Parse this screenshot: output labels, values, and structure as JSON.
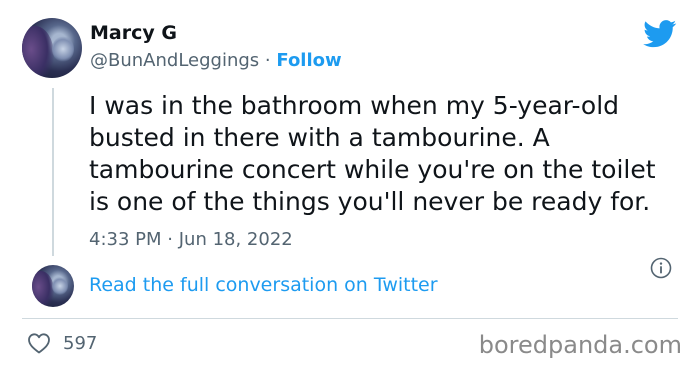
{
  "author": {
    "name": "Marcy G",
    "handle": "@BunAndLeggings",
    "separator": "·",
    "follow_label": "Follow"
  },
  "tweet": {
    "text": "I was in the bathroom when my 5-year-old\nbusted in there with a tambourine. A\ntambourine concert while you're on the toilet\nis one of the things you'll never be ready for.",
    "time": "4:33 PM",
    "separator": "·",
    "date": "Jun 18, 2022"
  },
  "conversation": {
    "link_label": "Read the full conversation on Twitter"
  },
  "engagement": {
    "likes": "597"
  },
  "watermark": "boredpanda.com",
  "colors": {
    "accent": "#1d9bf0",
    "text": "#0f1419",
    "muted": "#536471",
    "divider": "#cfd9de"
  },
  "icons": [
    "twitter-bird-icon",
    "info-icon",
    "heart-icon"
  ]
}
